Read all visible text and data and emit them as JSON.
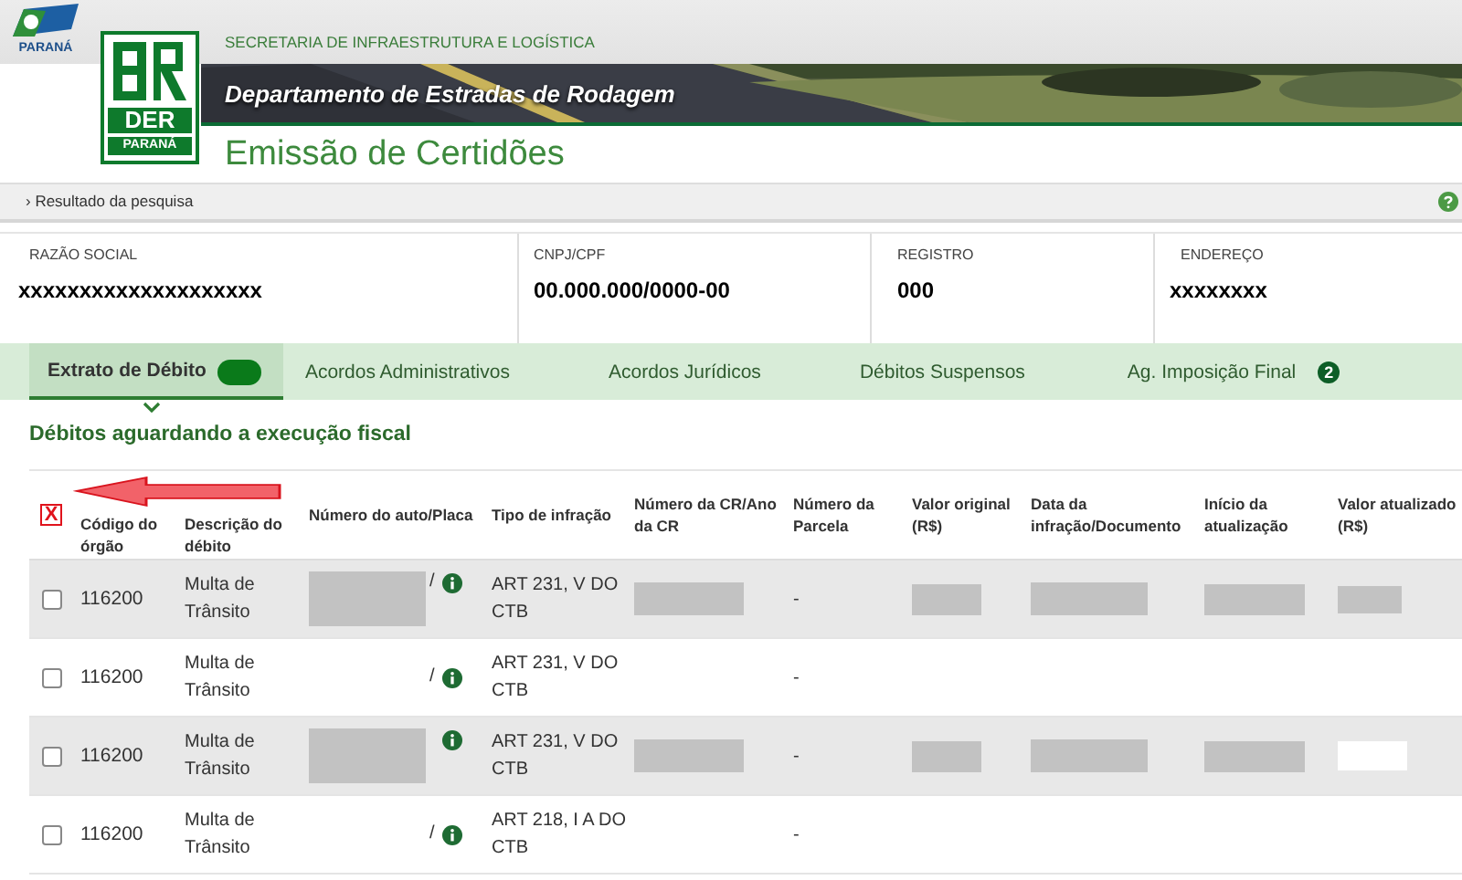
{
  "header": {
    "state_logo_text": "PARANÁ",
    "agency_logo": {
      "acronym": "DER",
      "state": "PARANÁ"
    },
    "secretariat": "SECRETARIA DE INFRAESTRUTURA E LOGÍSTICA",
    "department": "Departamento de Estradas de Rodagem",
    "page_title": "Emissão de Certidões"
  },
  "breadcrumb": "› Resultado da pesquisa",
  "info": [
    {
      "label": "RAZÃO SOCIAL",
      "value": "xxxxxxxxxxxxxxxxxxxx"
    },
    {
      "label": "CNPJ/CPF",
      "value": "00.000.000/0000-00"
    },
    {
      "label": "REGISTRO",
      "value": "000"
    },
    {
      "label": "ENDEREÇO",
      "value": "xxxxxxxx"
    }
  ],
  "tabs": [
    {
      "label": "Extrato de Débito",
      "selected": true,
      "badge": {
        "kind": "pill"
      }
    },
    {
      "label": "Acordos Administrativos",
      "selected": false
    },
    {
      "label": "Acordos Jurídicos",
      "selected": false
    },
    {
      "label": "Débitos Suspensos",
      "selected": false
    },
    {
      "label": "Ag. Imposição Final",
      "selected": false,
      "badge": {
        "kind": "count",
        "text": "2"
      }
    }
  ],
  "section_title": "Débitos aguardando a execução fiscal",
  "table": {
    "header_checkbox": {
      "annotation_mark": "X"
    },
    "columns": [
      "Código do órgão",
      "Descrição do débito",
      "Número do auto/Placa",
      "Tipo de infração",
      "Número da CR/Ano da CR",
      "Número da Parcela",
      "Valor original (R$)",
      "Data da infração/Documento",
      "Início da atualização",
      "Valor atualizado (R$)"
    ],
    "rows": [
      {
        "checked": false,
        "cells": [
          {
            "kind": "text",
            "text": "116200"
          },
          {
            "kind": "text",
            "text": "Multa de Trânsito"
          },
          {
            "kind": "auto",
            "redacted": true,
            "slash": "/"
          },
          {
            "kind": "text",
            "text": "ART 231, V DO CTB"
          },
          {
            "kind": "redacted"
          },
          {
            "kind": "text",
            "text": "-"
          },
          {
            "kind": "redacted"
          },
          {
            "kind": "redacted"
          },
          {
            "kind": "redacted"
          },
          {
            "kind": "redacted"
          }
        ]
      },
      {
        "checked": false,
        "cells": [
          {
            "kind": "text",
            "text": "116200"
          },
          {
            "kind": "text",
            "text": "Multa de Trânsito"
          },
          {
            "kind": "auto",
            "redacted": false,
            "slash": "/"
          },
          {
            "kind": "text",
            "text": "ART 231, V DO CTB"
          },
          {
            "kind": "empty"
          },
          {
            "kind": "text",
            "text": "-"
          },
          {
            "kind": "empty"
          },
          {
            "kind": "empty"
          },
          {
            "kind": "empty"
          },
          {
            "kind": "empty"
          }
        ]
      },
      {
        "checked": false,
        "cells": [
          {
            "kind": "text",
            "text": "116200"
          },
          {
            "kind": "text",
            "text": "Multa de Trânsito"
          },
          {
            "kind": "auto",
            "redacted": true
          },
          {
            "kind": "text",
            "text": "ART 231, V DO CTB"
          },
          {
            "kind": "redacted"
          },
          {
            "kind": "text",
            "text": "-"
          },
          {
            "kind": "redacted"
          },
          {
            "kind": "redacted"
          },
          {
            "kind": "redacted"
          },
          {
            "kind": "blank-box"
          }
        ]
      },
      {
        "checked": false,
        "cells": [
          {
            "kind": "text",
            "text": "116200"
          },
          {
            "kind": "text",
            "text": "Multa de Trânsito"
          },
          {
            "kind": "auto",
            "redacted": false,
            "slash": "/"
          },
          {
            "kind": "text",
            "text": "ART 218, I A DO CTB"
          },
          {
            "kind": "empty"
          },
          {
            "kind": "text",
            "text": "-"
          },
          {
            "kind": "empty"
          },
          {
            "kind": "empty"
          },
          {
            "kind": "empty"
          },
          {
            "kind": "empty"
          }
        ]
      }
    ]
  }
}
